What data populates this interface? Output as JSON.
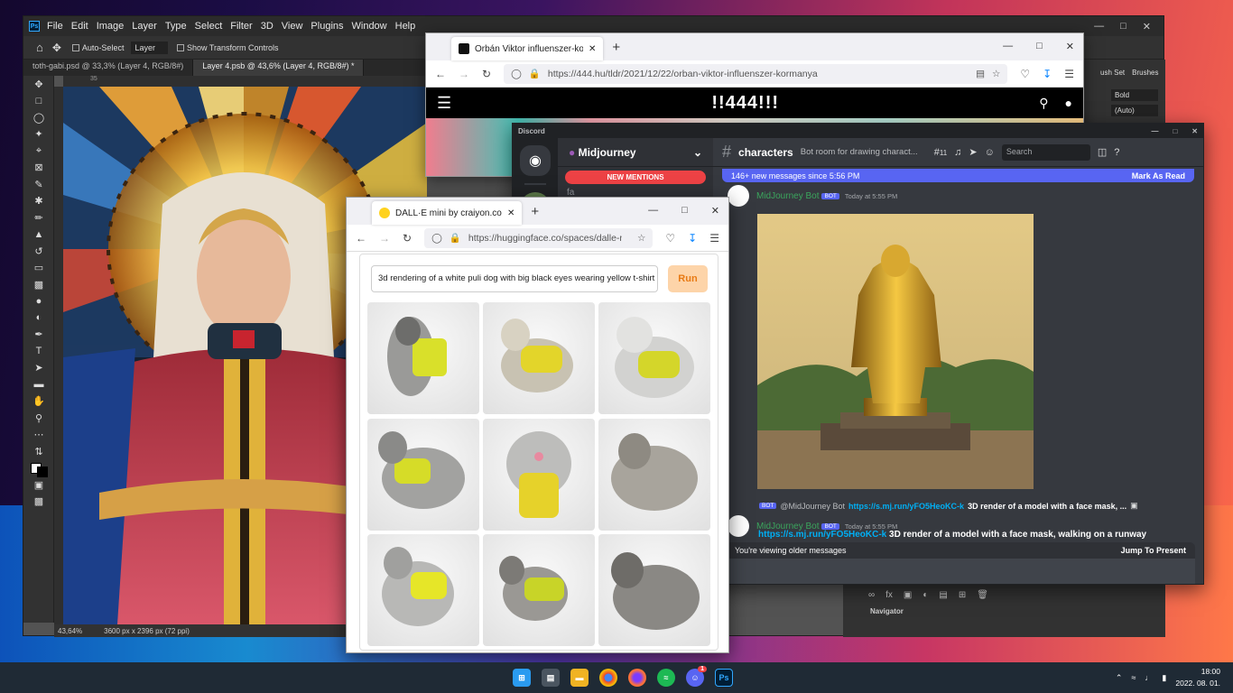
{
  "photoshop": {
    "menu": [
      "File",
      "Edit",
      "Image",
      "Layer",
      "Type",
      "Select",
      "Filter",
      "3D",
      "View",
      "Plugins",
      "Window",
      "Help"
    ],
    "options": {
      "auto_select": "Auto-Select",
      "layer": "Layer",
      "transform": "Show Transform Controls"
    },
    "tabs": [
      "toth-gabi.psd @ 33,3% (Layer 4, RGB/8#)",
      "Layer 4.psb @ 43,6% (Layer 4, RGB/8#) *"
    ],
    "status": {
      "zoom": "43,64%",
      "dims": "3600 px x 2396 px (72 ppi)"
    },
    "right_panel": {
      "brush_set": "ush Set",
      "brushes": "Brushes",
      "bold": "Bold",
      "auto": "(Auto)"
    },
    "navigator": "Navigator",
    "ruler_tick": "35"
  },
  "firefox444": {
    "tab_title": "Orbán Viktor influenszer-kormány",
    "url": "https://444.hu/tldr/2021/12/22/orban-viktor-influenszer-kormanya",
    "brand": "!!444!!!"
  },
  "discord": {
    "app_title": "Discord",
    "server": "Midjourney",
    "new_mentions": "NEW MENTIONS",
    "channel_partial": "fa",
    "channel": "characters",
    "topic": "Bot room for drawing charact...",
    "thread_count": "11",
    "search_placeholder": "Search",
    "new_messages": "146+ new messages since 5:56 PM",
    "mark_read": "Mark As Read",
    "bot_label": "BOT",
    "msg1": {
      "user": "MidJourney Bot",
      "time": "Today at 5:55 PM"
    },
    "reply": {
      "user": "@MidJourney Bot",
      "link": "https://s.mj.run/yFO5HeoKC-k",
      "text": "3D render of a model with a face mask, ..."
    },
    "msg2": {
      "user": "MidJourney Bot",
      "time": "Today at 5:55 PM",
      "link": "https://s.mj.run/yFO5HeoKC-k",
      "text": "3D render of a model with a face mask, walking on a runway"
    },
    "older_text": "You're viewing older messages",
    "jump": "Jump To Present"
  },
  "craiyon": {
    "tab_title": "DALL·E mini by craiyon.com on",
    "url": "https://huggingface.co/spaces/dalle-mi",
    "prompt": "3d rendering of a white puli dog with big black eyes wearing yellow t-shirt",
    "run": "Run"
  },
  "taskbar": {
    "apps": [
      "start",
      "calculator",
      "explorer",
      "chrome",
      "firefox",
      "spotify",
      "discord",
      "photoshop"
    ],
    "time": "18:00",
    "date": "2022. 08. 01.",
    "discord_badge": "1"
  },
  "colors": {
    "ps_bg": "#535353",
    "discord_bg": "#36393f",
    "blurple": "#5865f2",
    "mentions_red": "#ed4245",
    "run_orange": "#e87a14"
  }
}
